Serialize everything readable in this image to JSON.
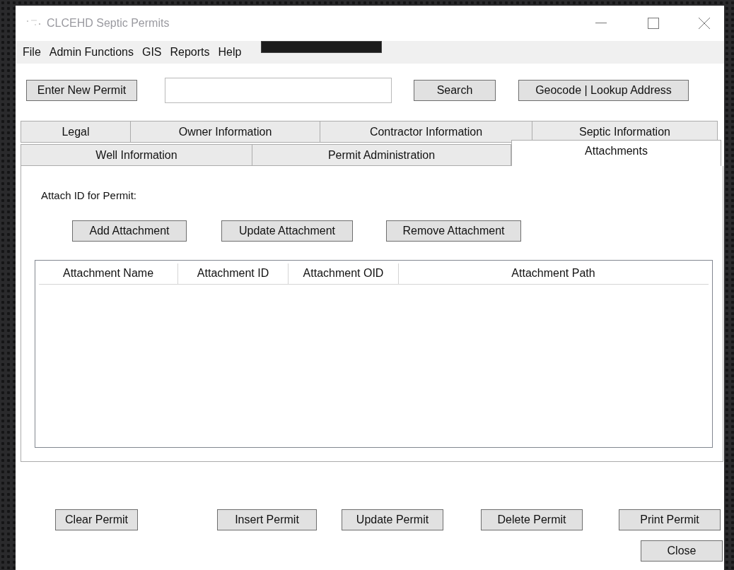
{
  "window": {
    "title": "CLCEHD Septic Permits"
  },
  "menu": [
    "File",
    "Admin Functions",
    "GIS",
    "Reports",
    "Help"
  ],
  "toolbar": {
    "new_button": "Enter New Permit",
    "search_button": "Search",
    "geocode_button": "Geocode | Lookup Address"
  },
  "tab_rows": [
    [
      {
        "label": "Legal",
        "selected": false
      },
      {
        "label": "Owner Information",
        "selected": false
      },
      {
        "label": "Contractor Information",
        "selected": false
      },
      {
        "label": "Septic Information",
        "selected": false
      }
    ],
    [
      {
        "label": "Well Information",
        "selected": false
      },
      {
        "label": "Permit Administration",
        "selected": false
      },
      {
        "label": "Attachments",
        "selected": true
      }
    ]
  ],
  "panel": {
    "label": "Attach ID for Permit:",
    "buttons": [
      "Add Attachment",
      "Update Attachment",
      "Remove Attachment"
    ],
    "table": {
      "columns": [
        "Attachment Name",
        "Attachment ID",
        "Attachment OID",
        "Attachment Path"
      ]
    }
  },
  "actions": [
    "Clear Permit",
    "Insert Permit",
    "Update Permit",
    "Delete Permit",
    "Print Permit"
  ],
  "close_button": "Close"
}
